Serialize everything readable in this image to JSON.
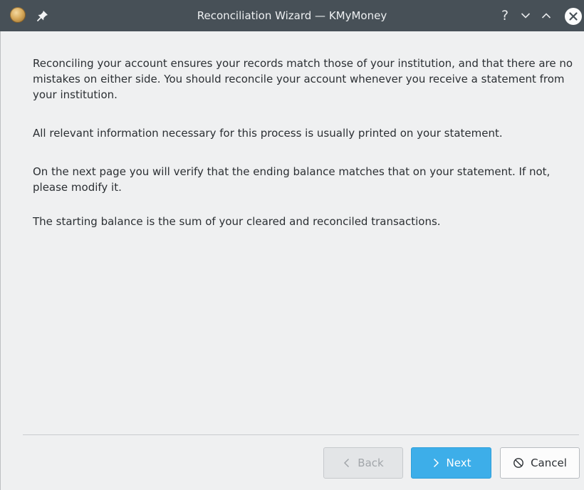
{
  "window": {
    "title": "Reconciliation Wizard — KMyMoney",
    "app_icon": "kmymoney-app-icon",
    "titlebar_buttons": {
      "pin": "pin-icon",
      "help": "?",
      "minimize": "chevron-down-icon",
      "maximize": "chevron-up-icon",
      "close": "close-icon"
    }
  },
  "intro": {
    "paragraphs": [
      "Reconciling your account ensures your records match those of your institution, and that there are no mistakes on either side. You should reconcile your account whenever you receive a statement from your institution.",
      "All relevant information necessary for this process is usually printed on your statement.",
      "On the next page you will verify that the ending balance matches that on your statement. If not, please modify it.",
      "The starting balance is the sum of your cleared and reconciled transactions."
    ]
  },
  "buttons": {
    "back": {
      "label": "Back",
      "icon": "chevron-left-icon",
      "enabled": false
    },
    "next": {
      "label": "Next",
      "icon": "chevron-right-icon",
      "enabled": true,
      "default": true
    },
    "cancel": {
      "label": "Cancel",
      "icon": "cancel-circle-icon",
      "enabled": true
    }
  },
  "colors": {
    "titlebar": "#475057",
    "background": "#eff0f1",
    "accent": "#3daee9",
    "text": "#2b2f33"
  }
}
